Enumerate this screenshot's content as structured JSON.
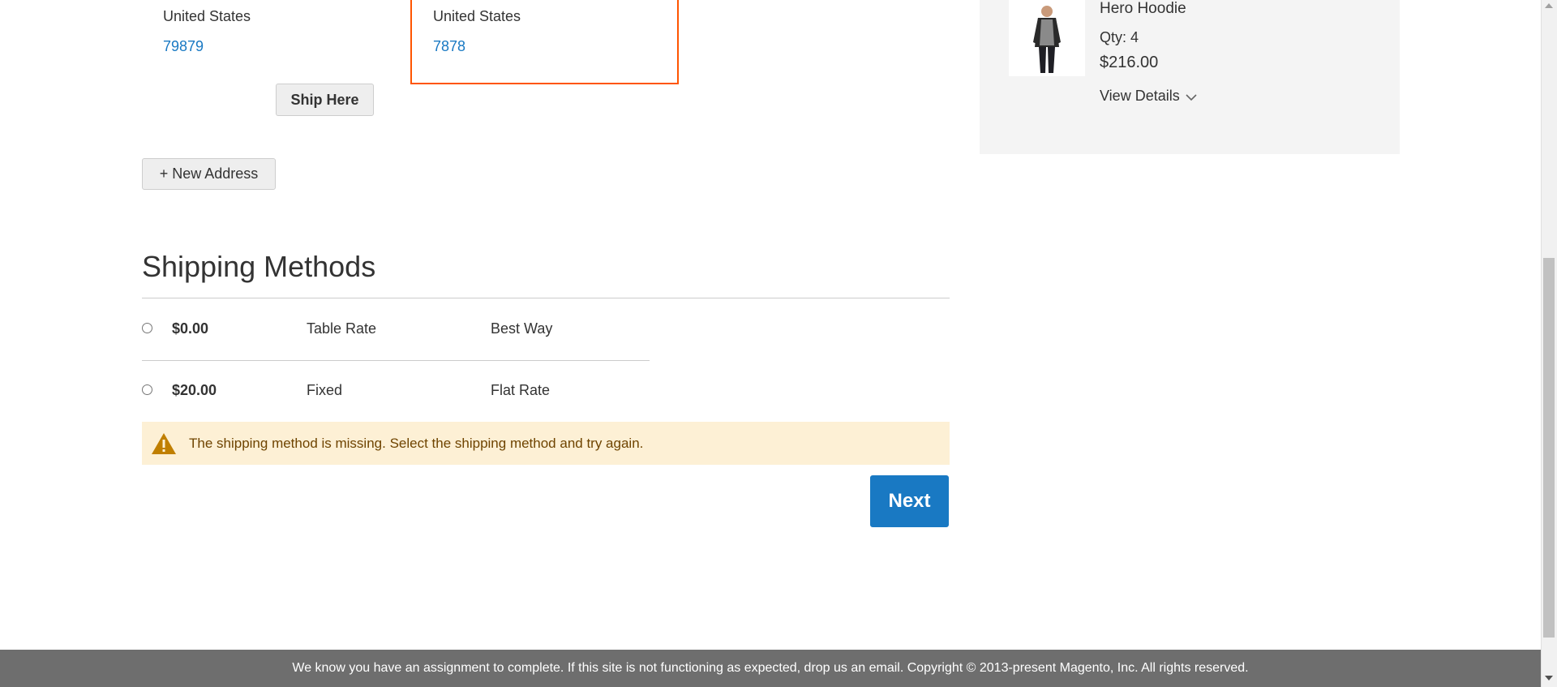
{
  "addresses": [
    {
      "country": "United States",
      "phone": "79879",
      "ship_button": "Ship Here"
    },
    {
      "country": "United States",
      "phone": "7878",
      "selected": true
    }
  ],
  "new_address_button": "+ New Address",
  "shipping": {
    "title": "Shipping Methods",
    "methods": [
      {
        "price": "$0.00",
        "method": "Table Rate",
        "carrier": "Best Way"
      },
      {
        "price": "$20.00",
        "method": "Fixed",
        "carrier": "Flat Rate"
      }
    ],
    "warning": "The shipping method is missing. Select the shipping method and try again.",
    "next_button": "Next"
  },
  "summary": {
    "product_name": "Hero Hoodie",
    "qty": "Qty: 4",
    "price": "$216.00",
    "view_details": "View Details"
  },
  "footer_text": "We know you have an assignment to complete. If this site is not functioning as expected, drop us an email. Copyright © 2013-present Magento, Inc. All rights reserved.",
  "colors": {
    "accent": "#1979c3",
    "selected_border": "#ff5501",
    "warning_bg": "#fdf0d5",
    "warning_icon": "#c07f00",
    "footer_bg": "#6e6e6e"
  }
}
